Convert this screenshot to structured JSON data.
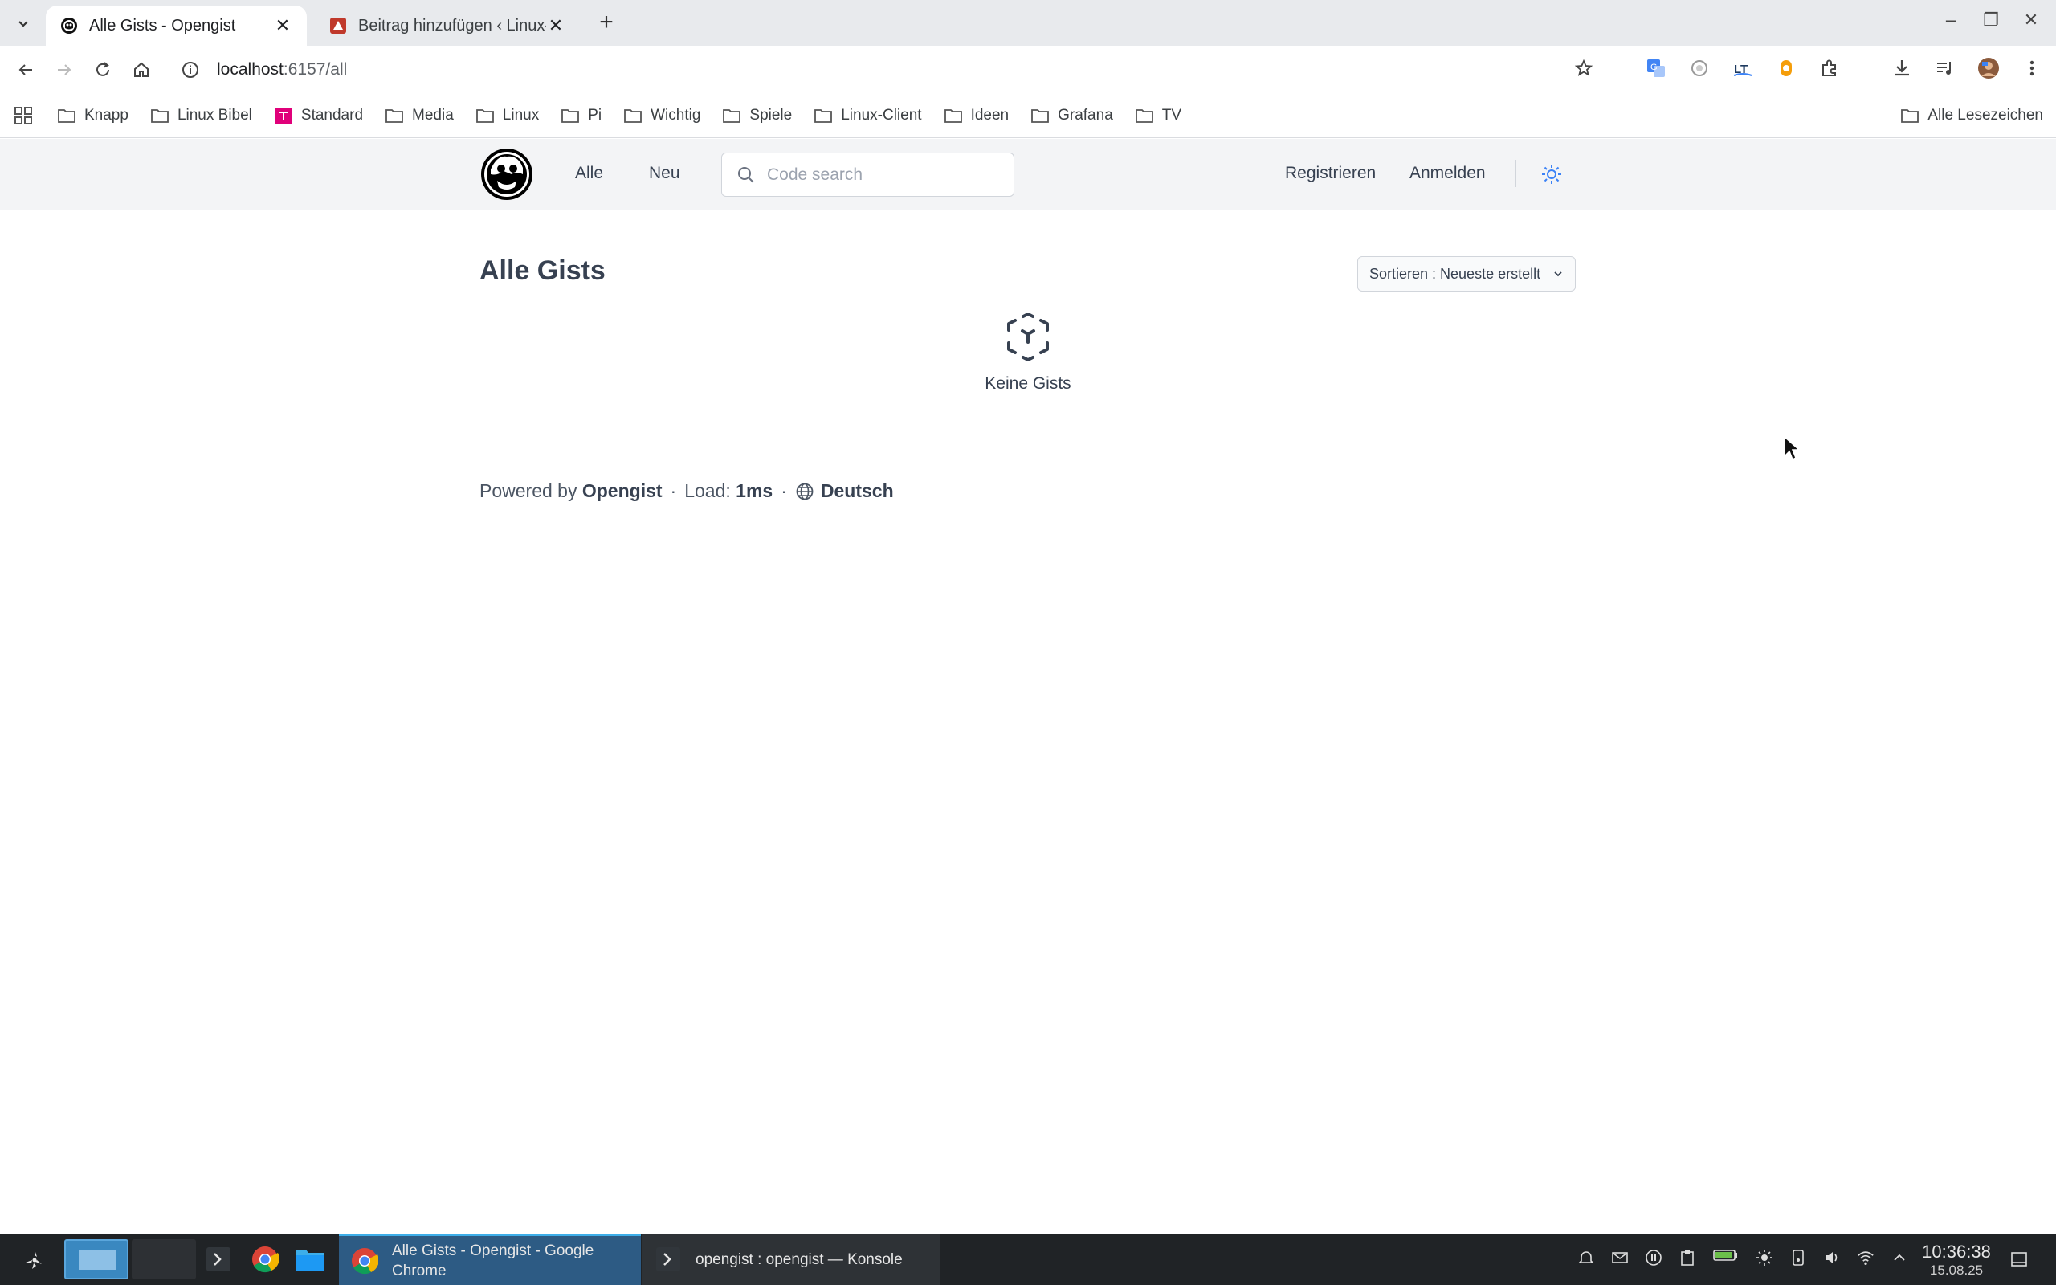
{
  "browser": {
    "tabs": [
      {
        "title": "Alle Gists - Opengist",
        "active": true
      },
      {
        "title": "Beitrag hinzufügen ‹ Linux-Bibel",
        "active": false
      }
    ],
    "url_host": "localhost",
    "url_path": ":6157/all",
    "bookmarks": [
      "Knapp",
      "Linux Bibel",
      "Standard",
      "Media",
      "Linux",
      "Pi",
      "Wichtig",
      "Spiele",
      "Linux-Client",
      "Ideen",
      "Grafana",
      "TV"
    ],
    "all_bookmarks": "Alle Lesezeichen"
  },
  "header": {
    "nav_all": "Alle",
    "nav_new": "Neu",
    "search_placeholder": "Code search",
    "register": "Registrieren",
    "login": "Anmelden"
  },
  "main": {
    "title": "Alle Gists",
    "sort_label": "Sortieren : Neueste erstellt",
    "empty_text": "Keine Gists"
  },
  "footer": {
    "powered_by": "Powered by",
    "brand": "Opengist",
    "load_label": "Load:",
    "load_value": "1ms",
    "language": "Deutsch"
  },
  "taskbar": {
    "task_chrome": "Alle Gists - Opengist - Google Chrome",
    "task_konsole": "opengist : opengist — Konsole",
    "time": "10:36:38",
    "date": "15.08.25",
    "battery_label": "94 %"
  },
  "colors": {
    "header_bg": "#f3f4f6",
    "accent_blue": "#3b82f6",
    "taskbar_bg": "#202326"
  }
}
